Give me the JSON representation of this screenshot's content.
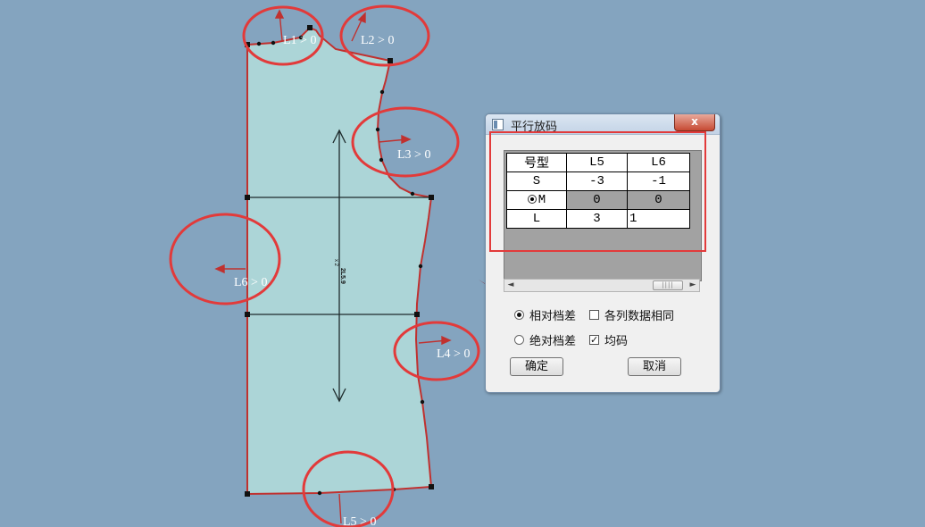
{
  "labels": {
    "l1": "L1 > 0",
    "l2": "L2 > 0",
    "l3": "L3 > 0",
    "l4": "L4 > 0",
    "l5": "L5 > 0",
    "l6": "L6 > 0"
  },
  "grain_label": "2L5.9",
  "grain_label_2": "x 2",
  "dialog": {
    "title": "平行放码",
    "close_glyph": "x",
    "table": {
      "headers": [
        "号型",
        "L5",
        "L6"
      ],
      "rows": [
        {
          "size": "S",
          "L5": "-3",
          "L6": "-1",
          "selected": false
        },
        {
          "size": "M",
          "L5": "0",
          "L6": "0",
          "selected": true
        },
        {
          "size": "L",
          "L5": "3",
          "L6": "1",
          "selected": false
        }
      ]
    },
    "scroll_left": "◄",
    "scroll_right": "►",
    "scroll_thumb": "||||",
    "options": {
      "relative": {
        "label": "相对档差",
        "checked": true
      },
      "absolute": {
        "label": "绝对档差",
        "checked": false
      },
      "same_column": {
        "label": "各列数据相同",
        "checked": false
      },
      "even": {
        "label": "均码",
        "checked": true
      }
    },
    "ok_label": "确定",
    "cancel_label": "取消",
    "check_glyph": "✓"
  },
  "colors": {
    "background": "#84a4bf",
    "pattern_fill": "#acd5d7",
    "outline": "#c0312f",
    "highlight": "#e23a3a",
    "pointer_arrow": "#8c1212"
  }
}
